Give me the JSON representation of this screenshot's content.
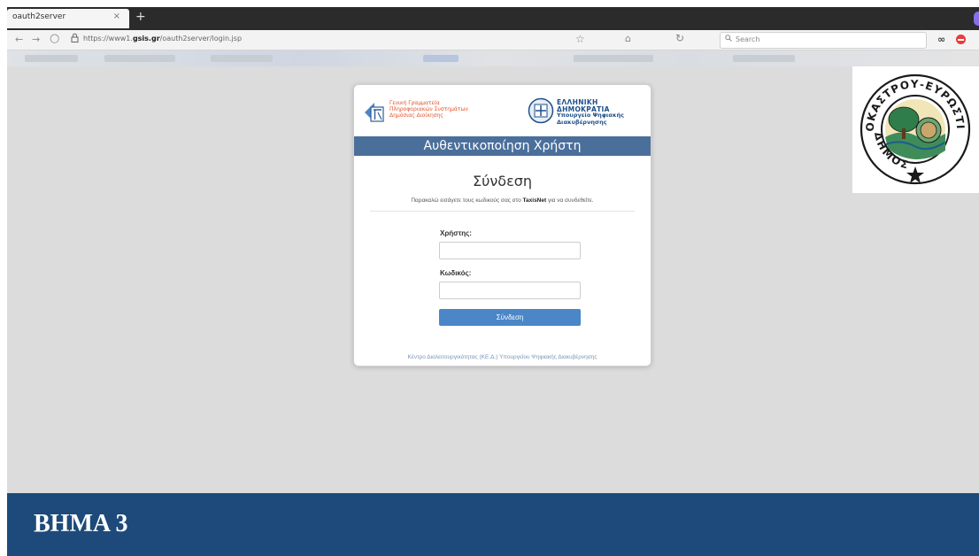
{
  "browser": {
    "tab_title": "oauth2server",
    "tab_close": "×",
    "new_tab": "+",
    "url_prefix": "https://www1.",
    "url_domain": "gsis.gr",
    "url_path": "/oauth2server/login.jsp",
    "search_placeholder": "Search",
    "icons": {
      "back": "←",
      "forward": "→",
      "reload": "○",
      "lock": "🔒",
      "bookmark": "☆",
      "home": "⌂",
      "refresh": "↻",
      "search": "🔍",
      "extension": "∞"
    }
  },
  "login": {
    "gsis_lines": [
      "Γενική Γραμματεία",
      "Πληροφοριακών Συστημάτων",
      "Δημόσιας Διοίκησης"
    ],
    "gr_lines": [
      "ΕΛΛΗΝΙΚΗ ΔΗΜΟΚΡΑΤΙΑ",
      "Υπουργείο Ψηφιακής",
      "Διακυβέρνησης"
    ],
    "header": "Αυθεντικοποίηση Χρήστη",
    "title": "Σύνδεση",
    "intro_before": "Παρακαλώ εισάγετε τους κωδικούς σας στο ",
    "intro_bold": "TaxisNet",
    "intro_after": " για να συνδεθείτε.",
    "username_label": "Χρήστης:",
    "username_value": "",
    "password_label": "Κωδικός:",
    "password_value": "",
    "submit_label": "Σύνδεση",
    "footer": "Κέντρο Διαλειτουργικότητας (ΚΕ.Δ.) Υπουργείου Ψηφιακής Διακυβέρνησης"
  },
  "seal": {
    "top_text": "ΔΗΜΟΣ ΣΥΚΟΚΑΣΤΡΟΥ-ΕΥΡΩΣΤΙΝΗΣ",
    "colors": {
      "ring": "#1a1a1a",
      "tree": "#2f7d4a",
      "sky": "#f1e6b8"
    }
  },
  "banner": {
    "step": "ΒΗΜΑ 3",
    "color": "#1d4a7a"
  }
}
